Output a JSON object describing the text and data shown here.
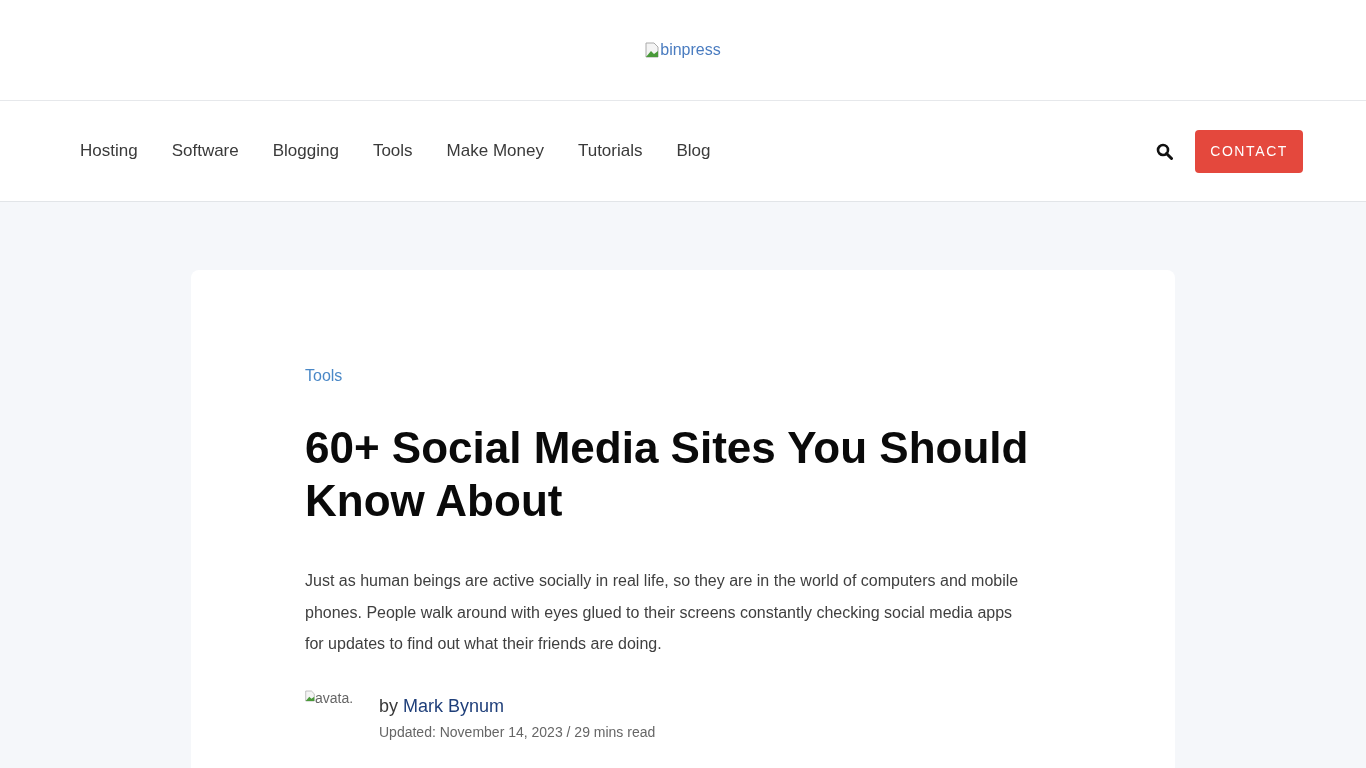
{
  "logo": {
    "alt": "binpress"
  },
  "nav": {
    "items": [
      "Hosting",
      "Software",
      "Blogging",
      "Tools",
      "Make Money",
      "Tutorials",
      "Blog"
    ],
    "contact_button": "CONTACT"
  },
  "article": {
    "category": "Tools",
    "title": "60+ Social Media Sites You Should Know About",
    "intro": "Just as human beings are active socially in real life, so they are in the world of computers and mobile phones. People walk around with eyes glued to their screens constantly checking social media apps for updates to find out what their friends are doing.",
    "author": {
      "avatar_alt": "avata.",
      "by": "by",
      "name": "Mark Bynum",
      "meta": "Updated: November 14, 2023 / 29 mins read"
    }
  }
}
